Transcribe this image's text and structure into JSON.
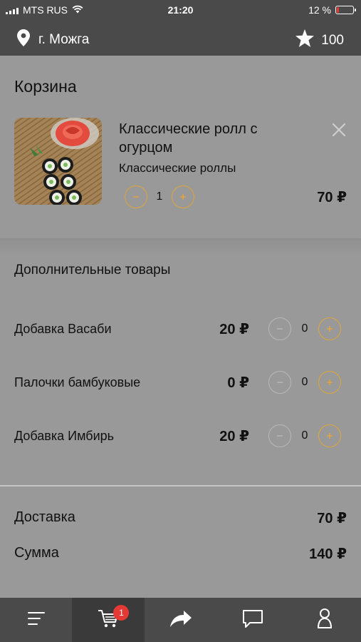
{
  "status_bar": {
    "carrier": "MTS RUS",
    "time": "21:20",
    "battery_text": "12 %",
    "battery_level": 0.12,
    "battery_color": "#e53935"
  },
  "header": {
    "city": "г. Можга",
    "city_icon": "location-pin-icon",
    "points": "100",
    "points_icon": "star-icon"
  },
  "cart": {
    "title": "Корзина",
    "item": {
      "name": "Классические ролл с огурцом",
      "category": "Классические роллы",
      "quantity": "1",
      "price": "70 ₽",
      "minus_icon": "minus-icon",
      "plus_icon": "plus-icon",
      "remove_icon": "close-icon"
    }
  },
  "extras": {
    "title": "Дополнительные товары",
    "items": [
      {
        "name": "Добавка Васаби",
        "price": "20 ₽",
        "quantity": "0"
      },
      {
        "name": "Палочки бамбуковые",
        "price": "0 ₽",
        "quantity": "0"
      },
      {
        "name": "Добавка Имбирь",
        "price": "20 ₽",
        "quantity": "0"
      }
    ]
  },
  "totals": {
    "delivery_label": "Доставка",
    "delivery_value": "70 ₽",
    "sum_label": "Сумма",
    "sum_value": "140 ₽"
  },
  "tabbar": {
    "tabs": [
      "menu-icon",
      "cart-icon",
      "share-icon",
      "chat-icon",
      "profile-icon"
    ],
    "cart_badge": "1",
    "active_tab": "cart-icon"
  },
  "colors": {
    "accent": "#e0a63a",
    "bar": "#4a4a4a",
    "background": "#999999",
    "badge": "#e53935"
  }
}
